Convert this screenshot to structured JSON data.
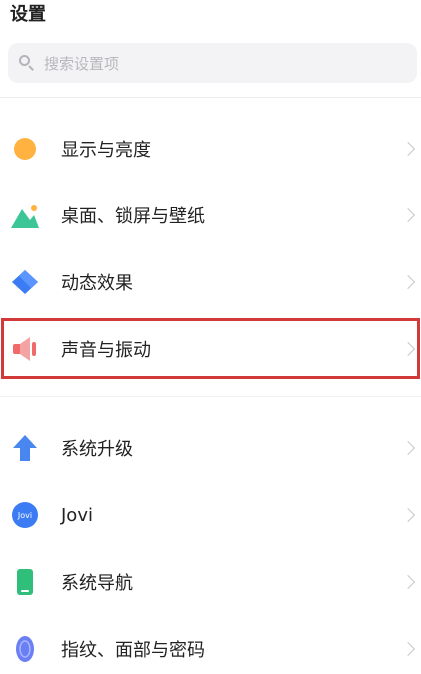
{
  "page": {
    "title": "设置"
  },
  "search": {
    "placeholder": "搜索设置项"
  },
  "groups": [
    {
      "items": [
        {
          "label": "显示与亮度",
          "icon": "sun-icon"
        },
        {
          "label": "桌面、锁屏与壁纸",
          "icon": "wallpaper-icon"
        },
        {
          "label": "动态效果",
          "icon": "motion-diamond-icon"
        },
        {
          "label": "声音与振动",
          "icon": "speaker-icon",
          "highlighted": true
        }
      ]
    },
    {
      "items": [
        {
          "label": "系统升级",
          "icon": "upgrade-arrow-icon"
        },
        {
          "label": "Jovi",
          "icon": "jovi-icon"
        },
        {
          "label": "系统导航",
          "icon": "phone-navigation-icon"
        },
        {
          "label": "指纹、面部与密码",
          "icon": "fingerprint-icon"
        }
      ]
    }
  ],
  "colors": {
    "highlight": "#d23a3a",
    "chevron": "#c8c8c8"
  }
}
